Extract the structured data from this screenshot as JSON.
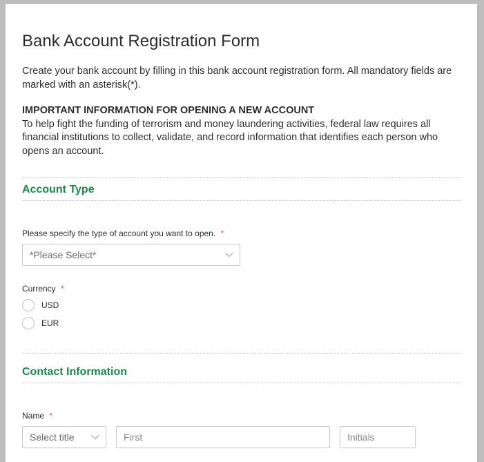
{
  "title": "Bank Account Registration Form",
  "intro": "Create your bank account by filling in this bank account registration form. All mandatory fields are marked with an asterisk(*).",
  "important": {
    "heading": "IMPORTANT INFORMATION FOR OPENING A NEW ACCOUNT",
    "body": "To help fight the funding of terrorism and money laundering activities, federal law requires all financial institutions to collect, validate, and record information that identifies each person who opens an account."
  },
  "sections": {
    "accountType": {
      "title": "Account Type",
      "typeLabel": "Please specify the type of account you want to open.",
      "typePlaceholder": "*Please Select*",
      "currencyLabel": "Currency",
      "radios": {
        "usd": "USD",
        "eur": "EUR"
      }
    },
    "contact": {
      "title": "Contact Information",
      "nameLabel": "Name",
      "titlePlaceholder": "Select title",
      "firstPlaceholder": "First",
      "initialsPlaceholder": "Initials"
    }
  },
  "requiredMark": "*"
}
